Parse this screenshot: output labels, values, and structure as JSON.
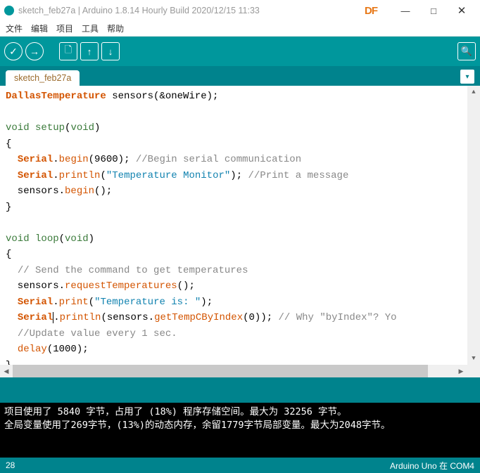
{
  "window": {
    "title": "sketch_feb27a | Arduino 1.8.14 Hourly Build 2020/12/15 11:33",
    "overlay": "DF",
    "minimize": "—",
    "maximize": "□",
    "close": "✕"
  },
  "menu": {
    "items": [
      "文件",
      "编辑",
      "项目",
      "工具",
      "帮助"
    ]
  },
  "toolbar": {
    "verify": "✓",
    "upload": "→",
    "new": "🗋",
    "open": "↑",
    "save": "↓",
    "monitor": "🔍"
  },
  "tab": {
    "name": "sketch_feb27a",
    "dropdown": "▾"
  },
  "code": {
    "l1_a": "DallasTemperature",
    "l1_b": " sensors(&oneWire);",
    "l3_a": "void",
    "l3_b": "setup",
    "l3_c": "(",
    "l3_d": "void",
    "l3_e": ")",
    "l4": "{",
    "l5_a": "  ",
    "l5_b": "Serial",
    "l5_c": ".",
    "l5_d": "begin",
    "l5_e": "(9600); ",
    "l5_f": "//Begin serial communication",
    "l6_a": "  ",
    "l6_b": "Serial",
    "l6_c": ".",
    "l6_d": "println",
    "l6_e": "(",
    "l6_f": "\"Temperature Monitor\"",
    "l6_g": "); ",
    "l6_h": "//Print a message",
    "l7_a": "  sensors.",
    "l7_b": "begin",
    "l7_c": "();",
    "l8": "}",
    "l10_a": "void",
    "l10_b": "loop",
    "l10_c": "(",
    "l10_d": "void",
    "l10_e": ")",
    "l11": "{",
    "l12_a": "  ",
    "l12_b": "// Send the command to get temperatures",
    "l13_a": "  sensors.",
    "l13_b": "requestTemperatures",
    "l13_c": "();",
    "l14_a": "  ",
    "l14_b": "Serial",
    "l14_c": ".",
    "l14_d": "print",
    "l14_e": "(",
    "l14_f": "\"Temperature is: \"",
    "l14_g": ");",
    "l15_a": "  ",
    "l15_b": "Serial",
    "l15_c": ".",
    "l15_d": "println",
    "l15_e": "(sensors.",
    "l15_f": "getTempCByIndex",
    "l15_g": "(0)); ",
    "l15_h": "// Why \"byIndex\"? Yo",
    "l16_a": "  ",
    "l16_b": "//Update value every 1 sec.",
    "l17_a": "  ",
    "l17_b": "delay",
    "l17_c": "(1000);",
    "l18": "}"
  },
  "console": {
    "line1": "项目使用了 5840 字节，占用了 (18%) 程序存储空间。最大为 32256 字节。",
    "line2": "全局变量使用了269字节，(13%)的动态内存，余留1779字节局部变量。最大为2048字节。"
  },
  "status": {
    "line": "28",
    "board": "Arduino Uno 在 COM4"
  },
  "scroll": {
    "up": "▲",
    "down": "▼",
    "left": "◀",
    "right": "▶"
  }
}
